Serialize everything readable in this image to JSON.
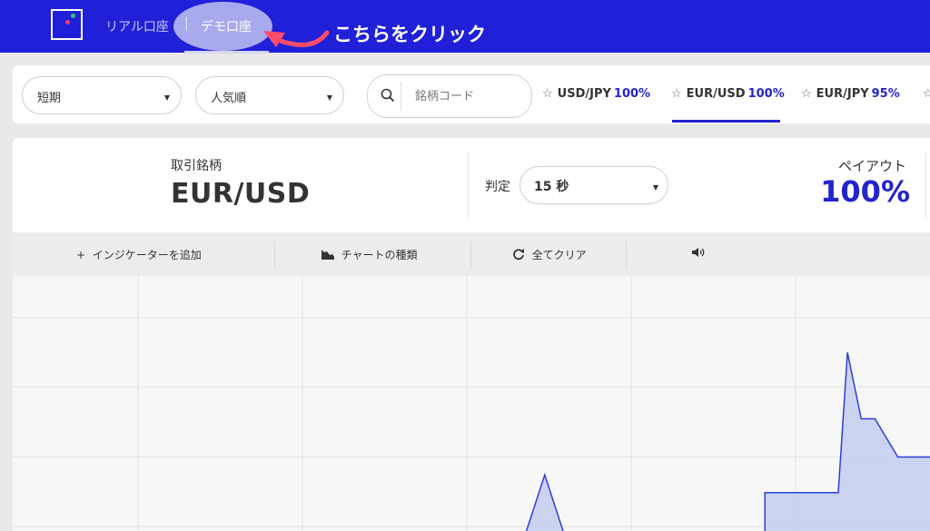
{
  "header": {
    "real_account": "リアル口座",
    "separator": "|",
    "demo_account": "デモ口座",
    "annotation": "こちらをクリック",
    "colors": {
      "bar": "#2020d8",
      "highlight": "#a9a9ee",
      "arrow": "#ff4d6a"
    }
  },
  "filters": {
    "period": "短期",
    "sort": "人気順",
    "search_placeholder": "銘柄コード"
  },
  "symbol_tabs": [
    {
      "symbol": "USD/JPY",
      "payout": "100%"
    },
    {
      "symbol": "EUR/USD",
      "payout": "100%"
    },
    {
      "symbol": "EUR/JPY",
      "payout": "95%"
    }
  ],
  "trade_info": {
    "symbol_label": "取引銘柄",
    "symbol": "EUR/USD",
    "expiry_label": "判定",
    "expiry_value": "15 秒",
    "payout_label": "ペイアウト",
    "payout_value": "100%"
  },
  "toolbar": {
    "add_indicator": "インジケーターを追加",
    "chart_type": "チャートの種類",
    "clear_all": "全てクリア"
  },
  "icons": [
    "logo-icon",
    "search-icon",
    "star-icon",
    "plus-icon",
    "chart-type-icon",
    "refresh-icon",
    "speaker-icon",
    "caret-down-icon"
  ],
  "chart_data": {
    "type": "area",
    "color": "#2e3fd6",
    "fill": "#c3ccf0",
    "series_points": [
      [
        0.56,
        0.0
      ],
      [
        0.58,
        0.22
      ],
      [
        0.6,
        0.0
      ],
      [
        0.82,
        0.15
      ],
      [
        0.9,
        0.15
      ],
      [
        0.91,
        0.7
      ],
      [
        0.925,
        0.44
      ],
      [
        0.94,
        0.44
      ],
      [
        0.965,
        0.29
      ],
      [
        1.0,
        0.29
      ]
    ]
  }
}
